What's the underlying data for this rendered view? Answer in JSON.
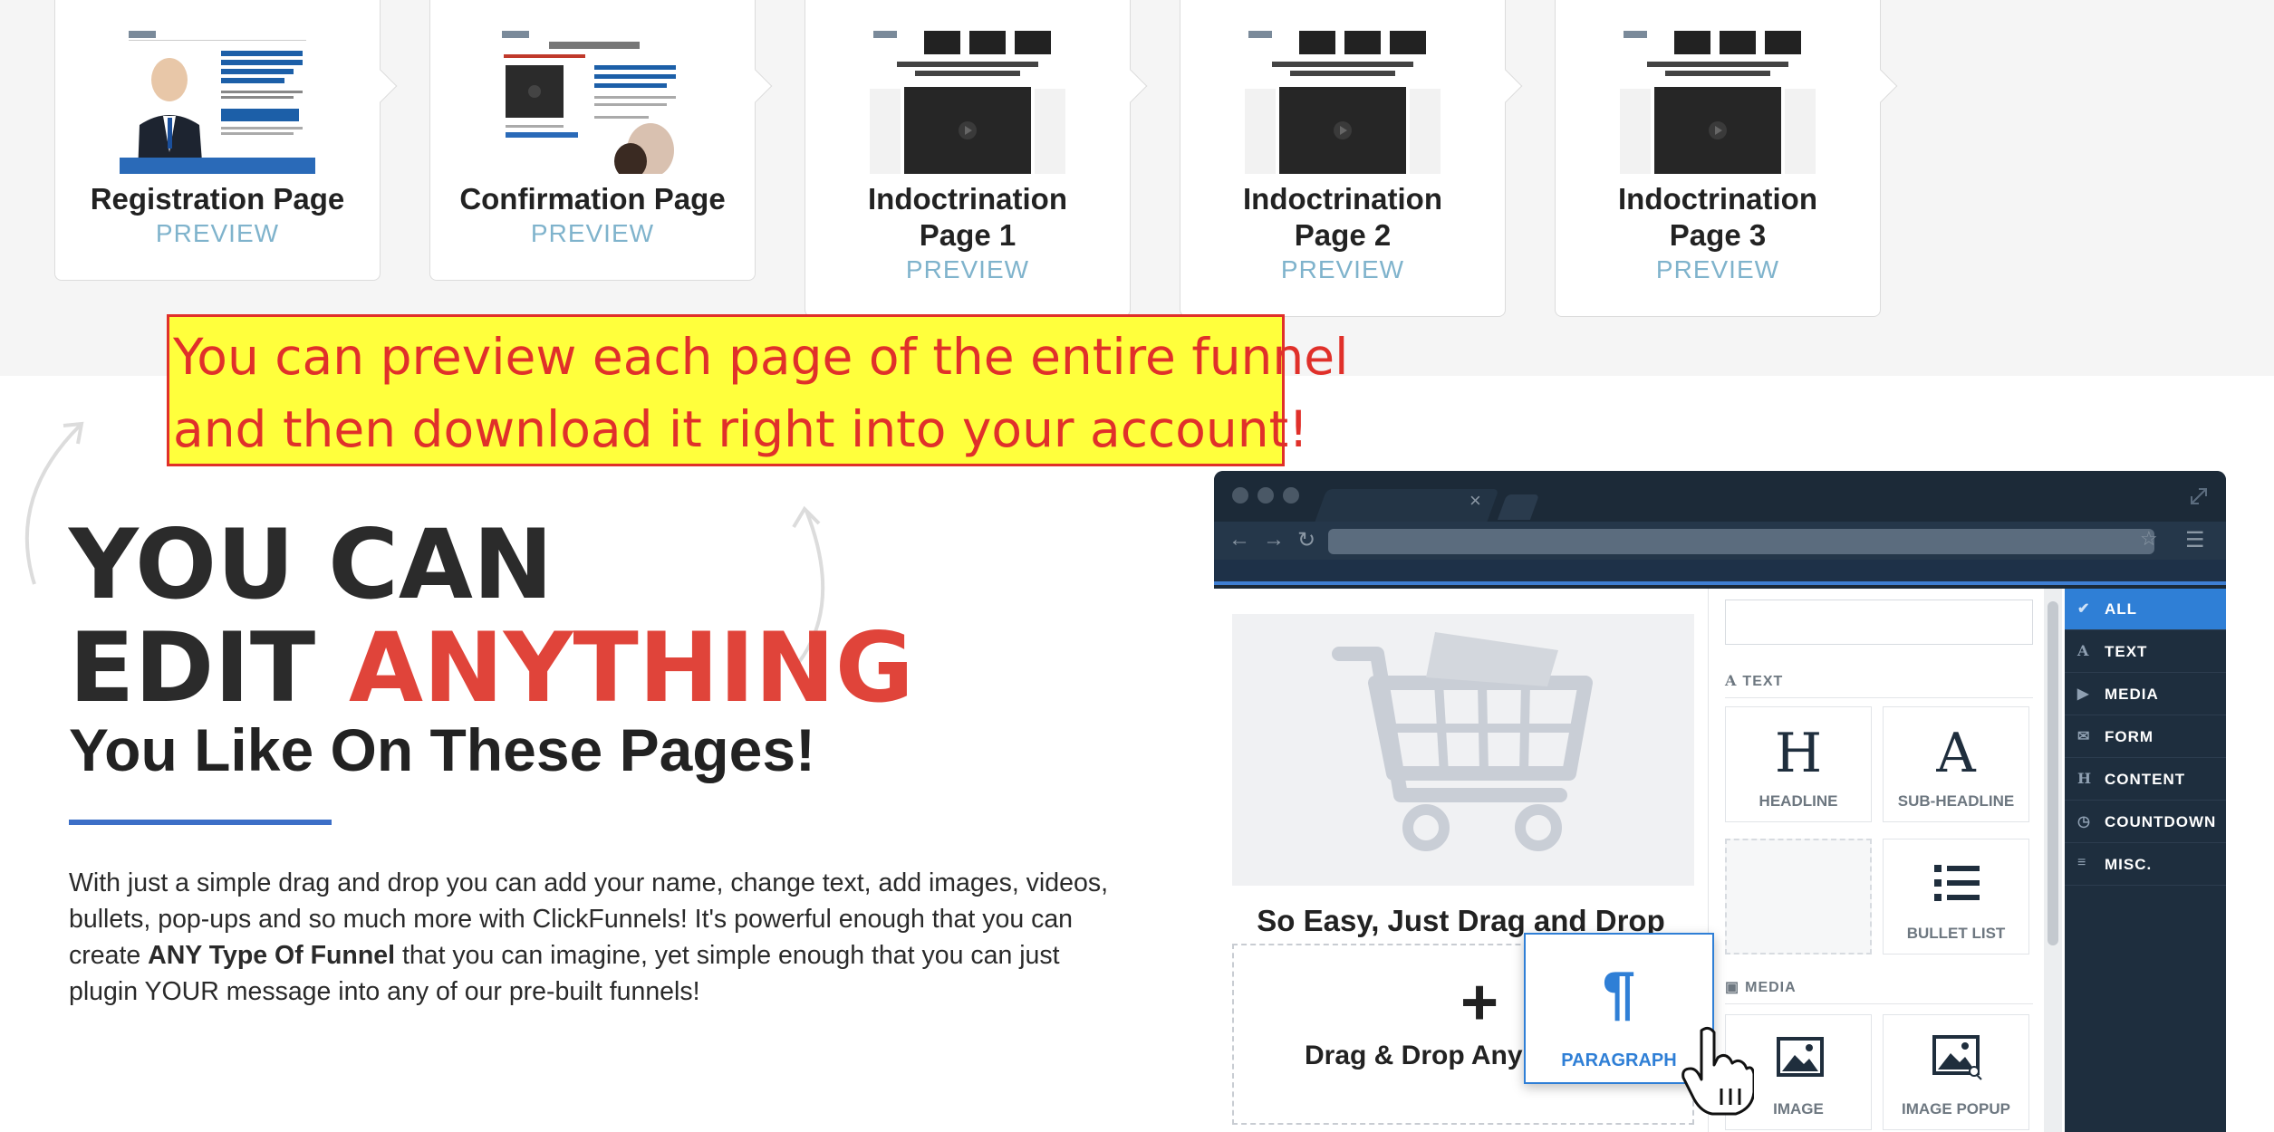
{
  "funnel_steps": [
    {
      "title_lines": [
        "Registration Page"
      ],
      "preview": "PREVIEW",
      "thumb": "registration-thumb"
    },
    {
      "title_lines": [
        "Confirmation Page"
      ],
      "preview": "PREVIEW",
      "thumb": "confirmation-thumb"
    },
    {
      "title_lines": [
        "Indoctrination",
        "Page 1"
      ],
      "preview": "PREVIEW",
      "thumb": "indoctrination-thumb"
    },
    {
      "title_lines": [
        "Indoctrination",
        "Page 2"
      ],
      "preview": "PREVIEW",
      "thumb": "indoctrination-thumb"
    },
    {
      "title_lines": [
        "Indoctrination",
        "Page 3"
      ],
      "preview": "PREVIEW",
      "thumb": "indoctrination-thumb"
    }
  ],
  "callout": {
    "line1": "You can preview each page of the entire funnel",
    "line2": "and then download it right into your account!"
  },
  "hero": {
    "line1": "YOU CAN",
    "line2_plain": "EDIT ",
    "line2_accent": "ANYTHING",
    "subheading": "You Like On These Pages!",
    "body_1": "With just a simple drag and drop you can add your name, change text, add images, videos, bullets, pop-ups and so much more with ClickFunnels! It's powerful enough that you can create ",
    "body_bold": "ANY Type Of Funnel",
    "body_2": " that you can imagine, yet simple enough that you can just plugin YOUR message into any of our pre-built funnels!"
  },
  "editor": {
    "tab_close": "×",
    "canvas_title": "So Easy, Just Drag and Drop",
    "drop_plus": "+",
    "drop_text": "Drag & Drop Any",
    "sections": {
      "text": "TEXT",
      "media": "MEDIA"
    },
    "tiles": {
      "headline": {
        "glyph": "H",
        "label": "HEADLINE"
      },
      "subheadline": {
        "glyph": "A",
        "label": "SUB-HEADLINE"
      },
      "bullet_list": {
        "label": "BULLET LIST"
      },
      "image": {
        "label": "IMAGE"
      },
      "image_popup": {
        "label": "IMAGE POPUP"
      }
    },
    "dragging": {
      "glyph": "¶",
      "label": "PARAGRAPH"
    },
    "sidenav": [
      {
        "label": "ALL",
        "icon": "pointer-icon",
        "glyph": "✔",
        "active": true
      },
      {
        "label": "TEXT",
        "icon": "text-icon",
        "glyph": "A",
        "active": false
      },
      {
        "label": "MEDIA",
        "icon": "play-icon",
        "glyph": "▶",
        "active": false
      },
      {
        "label": "FORM",
        "icon": "envelope-icon",
        "glyph": "✉",
        "active": false
      },
      {
        "label": "CONTENT",
        "icon": "heading-icon",
        "glyph": "H",
        "active": false
      },
      {
        "label": "COUNTDOWN",
        "icon": "clock-icon",
        "glyph": "◷",
        "active": false
      },
      {
        "label": "MISC.",
        "icon": "menu-icon",
        "glyph": "≡",
        "active": false
      }
    ]
  },
  "colors": {
    "accent_red": "#e0443a",
    "callout_yellow": "#ffff3c",
    "callout_border": "#e0302a",
    "editor_blue": "#2f7fd6",
    "preview_link": "#7fb3cc",
    "divider_blue": "#3c6fc7"
  }
}
